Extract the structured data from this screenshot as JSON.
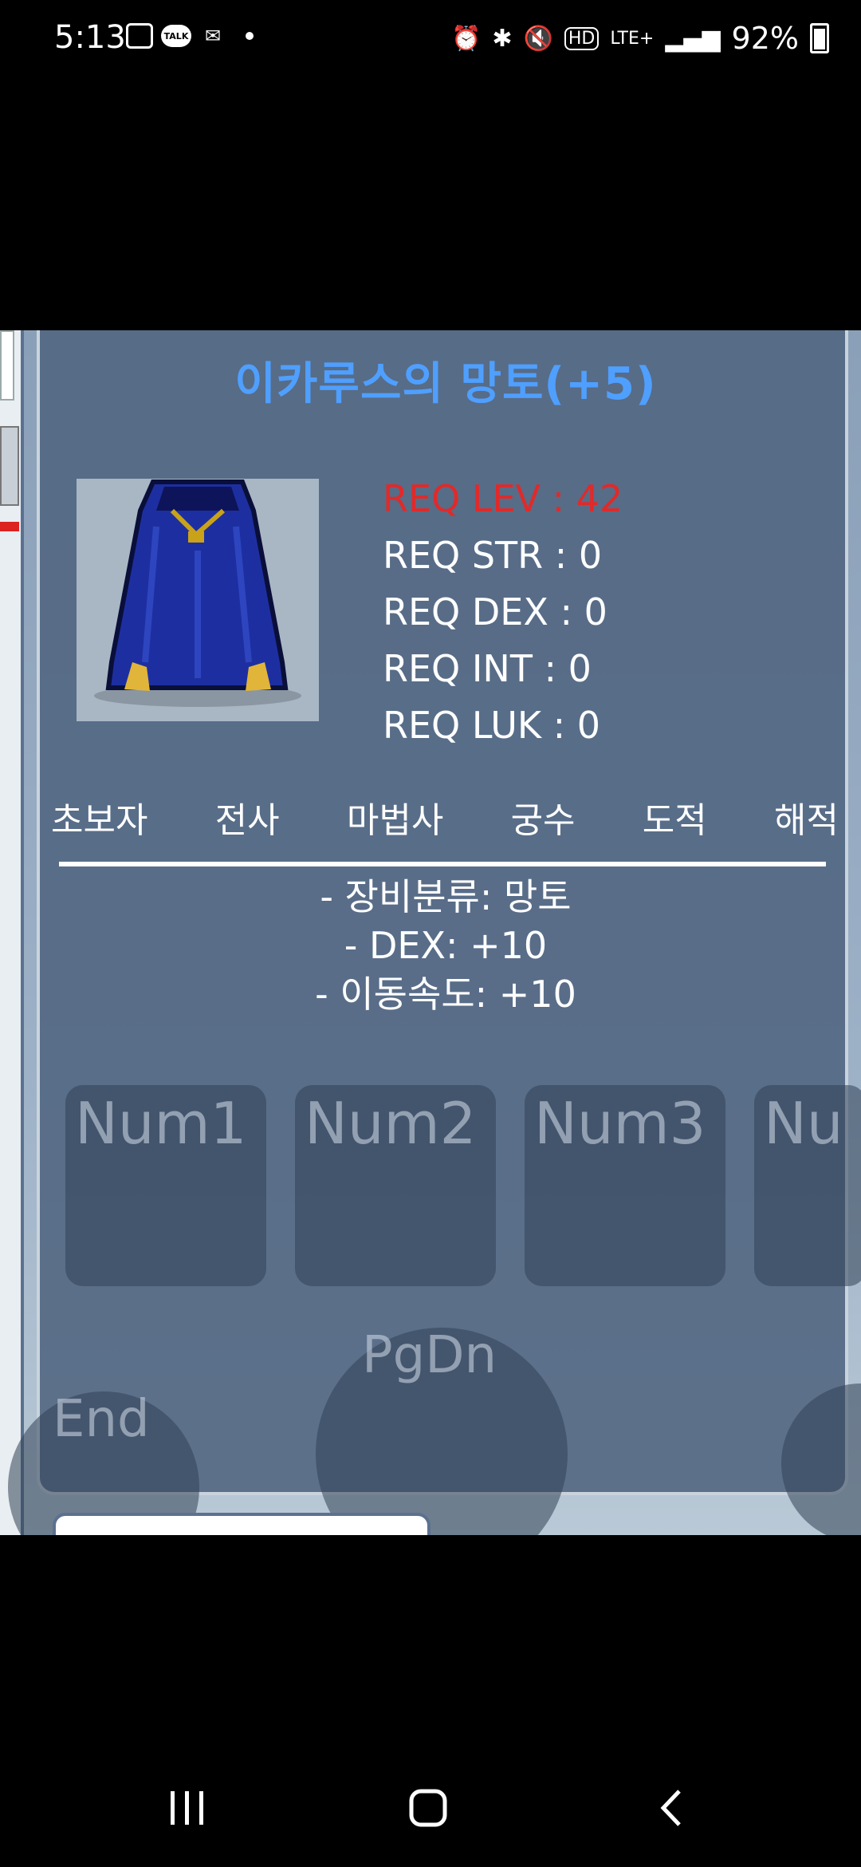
{
  "status_bar": {
    "time": "5:13",
    "left_icons": [
      "gallery-icon",
      "kakaotalk-icon",
      "kakao-notification-icon"
    ],
    "right_icons": [
      "alarm-icon",
      "bluetooth-icon",
      "mute-icon",
      "hd-voice-icon",
      "lte-plus-icon",
      "signal-icon"
    ],
    "battery": "92%",
    "talk_badge": "TALK"
  },
  "item_tooltip": {
    "title": "이카루스의 망토(+5)",
    "item_icon": "blue-cape-icon",
    "requirements": {
      "lev": "REQ LEV : 42",
      "str": "REQ STR : 0",
      "dex": "REQ DEX : 0",
      "int": "REQ INT : 0",
      "luk": "REQ LUK : 0"
    },
    "req_lev_color": "#e02a2a",
    "title_color": "#4f9fff",
    "jobs": [
      "초보자",
      "전사",
      "마법사",
      "궁수",
      "도적",
      "해적"
    ],
    "stats": [
      "- 장비분류: 망토",
      "- DEX: +10",
      "- 이동속도: +10"
    ]
  },
  "hotkeys": {
    "num1": "Num1",
    "num2": "Num2",
    "num3": "Num3",
    "num4_partial": "Nu",
    "end": "End",
    "pgdn": "PgDn"
  },
  "nav_bar": {
    "recents": "recents-icon",
    "home": "home-icon",
    "back": "back-icon"
  }
}
